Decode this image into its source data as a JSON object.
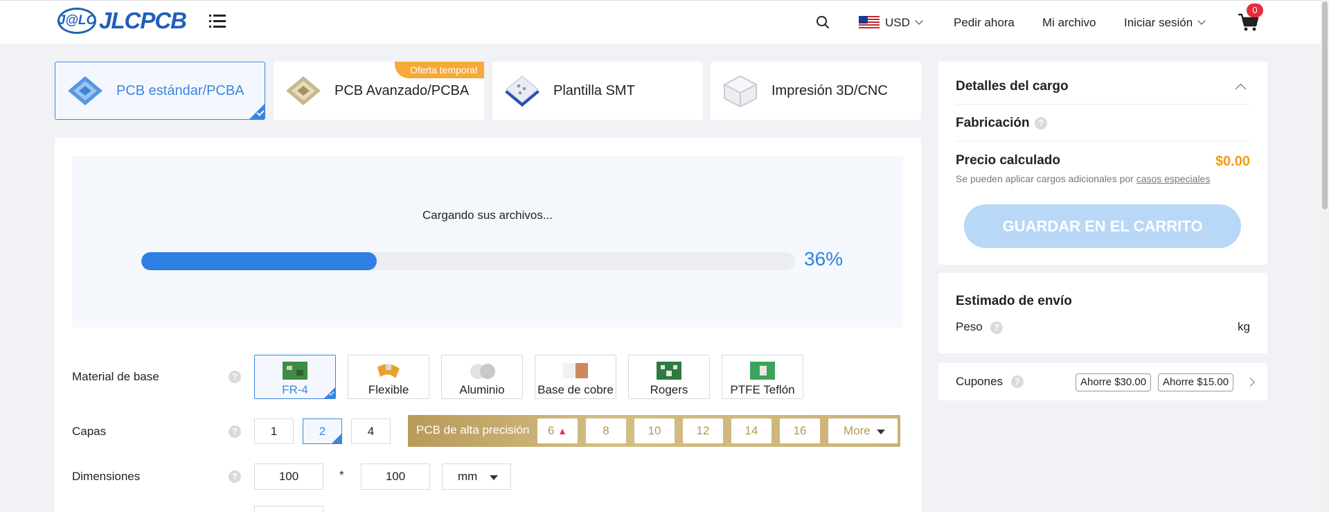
{
  "header": {
    "logo_mark": "J@LC",
    "logo_text": "JLCPCB",
    "currency": "USD",
    "nav": [
      "Pedir ahora",
      "Mi archivo",
      "Iniciar sesión"
    ],
    "cart_count": "0"
  },
  "tabs": [
    {
      "label": "PCB estándar/PCBA",
      "active": true
    },
    {
      "label": "PCB Avanzado/PCBA",
      "badge": "Oferta temporal"
    },
    {
      "label": "Plantilla SMT"
    },
    {
      "label": "Impresión 3D/CNC"
    }
  ],
  "upload": {
    "status_text": "Cargando sus archivos...",
    "progress": 36,
    "progress_label": "36%"
  },
  "form": {
    "base_material": {
      "label": "Material de base",
      "options": [
        "FR-4",
        "Flexible",
        "Aluminio",
        "Base de cobre",
        "Rogers",
        "PTFE Teflón"
      ],
      "selected": "FR-4"
    },
    "layers": {
      "label": "Capas",
      "options": [
        "1",
        "2",
        "4"
      ],
      "selected": "2",
      "high_precision_label": "PCB de alta precisión",
      "high_precision_options": [
        "6",
        "8",
        "10",
        "12",
        "14",
        "16"
      ],
      "more_label": "More"
    },
    "dimensions": {
      "label": "Dimensiones",
      "width": "100",
      "separator": "*",
      "height": "100",
      "unit": "mm"
    }
  },
  "charges": {
    "title": "Detalles del cargo",
    "fabrication_label": "Fabricación",
    "calculated_price_label": "Precio calculado",
    "calculated_price": "$0.00",
    "note_prefix": "Se pueden aplicar cargos adicionales por",
    "note_link": "casos especiales",
    "cart_button": "GUARDAR EN EL CARRITO"
  },
  "shipping": {
    "title": "Estimado de envío",
    "weight_label": "Peso",
    "weight_unit": "kg"
  },
  "coupons": {
    "label": "Cupones",
    "items": [
      "Ahorre $30.00",
      "Ahorre $15.00"
    ]
  },
  "colors": {
    "accent": "#2f80e4",
    "price": "#f39c12",
    "gold": "#c9ad6e"
  }
}
